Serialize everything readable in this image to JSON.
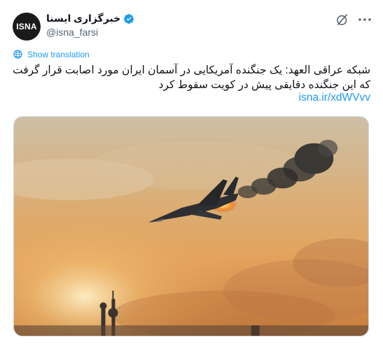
{
  "account": {
    "avatar_text": "ISNA",
    "display_name": "خبرگزاری ایسنا",
    "handle": "@isna_farsi",
    "verified": true
  },
  "icons": {
    "grok": "grok-icon",
    "more": "more-options-icon",
    "translate": "globe-icon",
    "verified": "verified-badge-icon"
  },
  "translate": {
    "label": "Show translation"
  },
  "tweet": {
    "text": "شبکه عراقی العهد: یک جنگنده آمریکایی در آسمان ایران مورد اصابت قرار گرفت که این جنگنده دقایقی پیش در کویت سقوط کرد",
    "link": "isna.ir/xdWVvv"
  },
  "colors": {
    "accent": "#1d9bf0",
    "text": "#0f1419",
    "muted": "#536471",
    "border": "#cfd9de"
  }
}
